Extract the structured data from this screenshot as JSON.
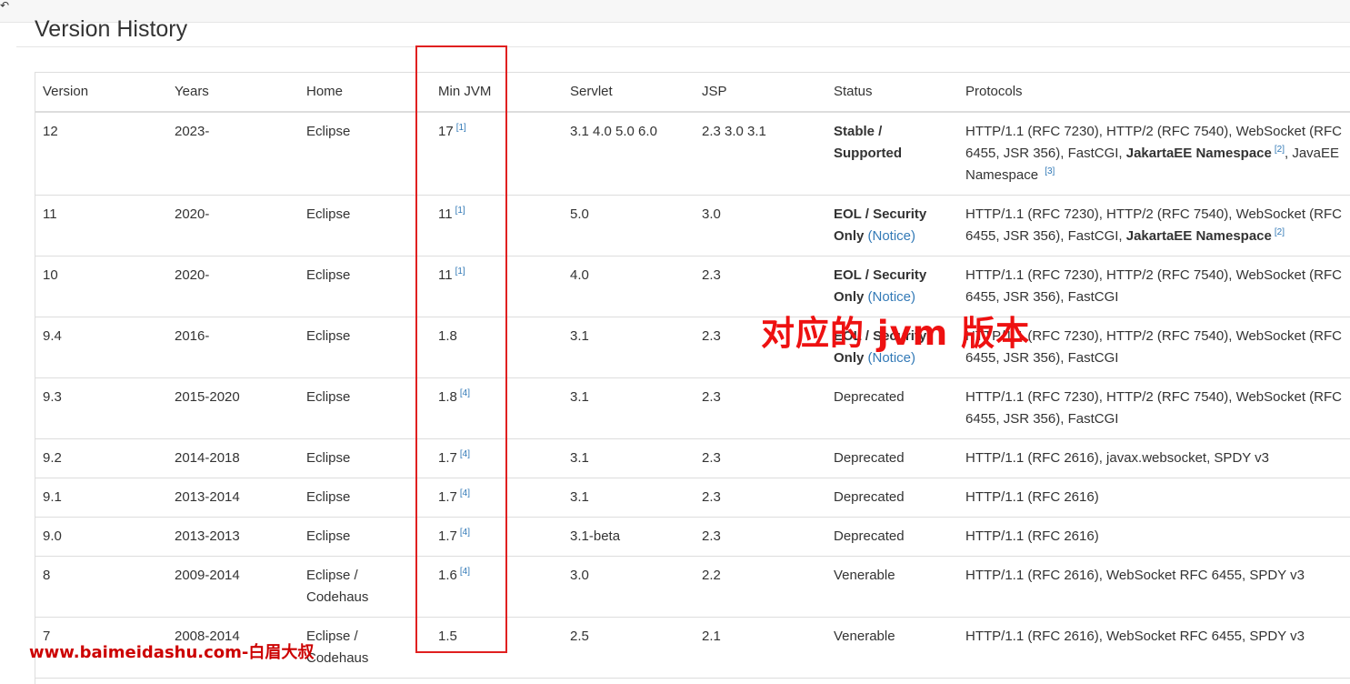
{
  "corner_icon": "↶",
  "page": {
    "title": "Version History"
  },
  "table": {
    "headers": [
      "Version",
      "Years",
      "Home",
      "Min JVM",
      "Servlet",
      "JSP",
      "Status",
      "Protocols"
    ],
    "rows": [
      {
        "version": "12",
        "years": "2023-",
        "home": "Eclipse",
        "jvm": "17",
        "jvm_ref": "[1]",
        "servlet": "3.1 4.0 5.0 6.0",
        "jsp": "2.3 3.0 3.1",
        "status_parts": [
          {
            "text": "Stable / Supported",
            "bold": true
          }
        ],
        "protocol_parts": [
          {
            "text": "HTTP/1.1 (RFC 7230), HTTP/2 (RFC 7540), WebSocket (RFC 6455, JSR 356), FastCGI, "
          },
          {
            "text": "JakartaEE Namespace",
            "bold": true
          },
          {
            "text": "[2]",
            "sup": true
          },
          {
            "text": ", JavaEE Namespace "
          },
          {
            "text": "[3]",
            "sup": true
          }
        ]
      },
      {
        "version": "11",
        "years": "2020-",
        "home": "Eclipse",
        "jvm": "11",
        "jvm_ref": "[1]",
        "servlet": "5.0",
        "jsp": "3.0",
        "status_parts": [
          {
            "text": "EOL / Security Only",
            "bold": true
          },
          {
            "text": " (Notice)",
            "link": true
          }
        ],
        "protocol_parts": [
          {
            "text": "HTTP/1.1 (RFC 7230), HTTP/2 (RFC 7540), WebSocket (RFC 6455, JSR 356), FastCGI, "
          },
          {
            "text": "JakartaEE Namespace",
            "bold": true
          },
          {
            "text": "[2]",
            "sup": true
          }
        ]
      },
      {
        "version": "10",
        "years": "2020-",
        "home": "Eclipse",
        "jvm": "11",
        "jvm_ref": "[1]",
        "servlet": "4.0",
        "jsp": "2.3",
        "status_parts": [
          {
            "text": "EOL / Security Only",
            "bold": true
          },
          {
            "text": " (Notice)",
            "link": true
          }
        ],
        "protocol_parts": [
          {
            "text": "HTTP/1.1 (RFC 7230), HTTP/2 (RFC 7540), WebSocket (RFC 6455, JSR 356), FastCGI"
          }
        ]
      },
      {
        "version": "9.4",
        "years": "2016-",
        "home": "Eclipse",
        "jvm": "1.8",
        "jvm_ref": "",
        "servlet": "3.1",
        "jsp": "2.3",
        "status_parts": [
          {
            "text": "EOL / Security Only",
            "bold": true
          },
          {
            "text": " (Notice)",
            "link": true
          }
        ],
        "protocol_parts": [
          {
            "text": "HTTP/1.1 (RFC 7230), HTTP/2 (RFC 7540), WebSocket (RFC 6455, JSR 356), FastCGI"
          }
        ]
      },
      {
        "version": "9.3",
        "years": "2015-2020",
        "home": "Eclipse",
        "jvm": "1.8",
        "jvm_ref": "[4]",
        "servlet": "3.1",
        "jsp": "2.3",
        "status_parts": [
          {
            "text": "Deprecated"
          }
        ],
        "protocol_parts": [
          {
            "text": "HTTP/1.1 (RFC 7230), HTTP/2 (RFC 7540), WebSocket (RFC 6455, JSR 356), FastCGI"
          }
        ]
      },
      {
        "version": "9.2",
        "years": "2014-2018",
        "home": "Eclipse",
        "jvm": "1.7",
        "jvm_ref": "[4]",
        "servlet": "3.1",
        "jsp": "2.3",
        "status_parts": [
          {
            "text": "Deprecated"
          }
        ],
        "protocol_parts": [
          {
            "text": "HTTP/1.1 (RFC 2616), javax.websocket, SPDY v3"
          }
        ]
      },
      {
        "version": "9.1",
        "years": "2013-2014",
        "home": "Eclipse",
        "jvm": "1.7",
        "jvm_ref": "[4]",
        "servlet": "3.1",
        "jsp": "2.3",
        "status_parts": [
          {
            "text": "Deprecated"
          }
        ],
        "protocol_parts": [
          {
            "text": "HTTP/1.1 (RFC 2616)"
          }
        ]
      },
      {
        "version": "9.0",
        "years": "2013-2013",
        "home": "Eclipse",
        "jvm": "1.7",
        "jvm_ref": "[4]",
        "servlet": "3.1-beta",
        "jsp": "2.3",
        "status_parts": [
          {
            "text": "Deprecated"
          }
        ],
        "protocol_parts": [
          {
            "text": "HTTP/1.1 (RFC 2616)"
          }
        ]
      },
      {
        "version": "8",
        "years": "2009-2014",
        "home": "Eclipse / Codehaus",
        "jvm": "1.6",
        "jvm_ref": "[4]",
        "servlet": "3.0",
        "jsp": "2.2",
        "status_parts": [
          {
            "text": "Venerable"
          }
        ],
        "protocol_parts": [
          {
            "text": "HTTP/1.1 (RFC 2616), WebSocket RFC 6455, SPDY v3"
          }
        ]
      },
      {
        "version": "7",
        "years": "2008-2014",
        "home": "Eclipse / Codehaus",
        "jvm": "1.5",
        "jvm_ref": "",
        "servlet": "2.5",
        "jsp": "2.1",
        "status_parts": [
          {
            "text": "Venerable"
          }
        ],
        "protocol_parts": [
          {
            "text": "HTTP/1.1 (RFC 2616), WebSocket RFC 6455, SPDY v3"
          }
        ]
      }
    ]
  },
  "annotation": {
    "text": "对应的 jvm 版本"
  },
  "watermark": {
    "text": "www.baimeidashu.com-白眉大叔"
  },
  "colors": {
    "highlight": "#e02020",
    "annotation": "#ee1111",
    "link": "#337ab7"
  }
}
